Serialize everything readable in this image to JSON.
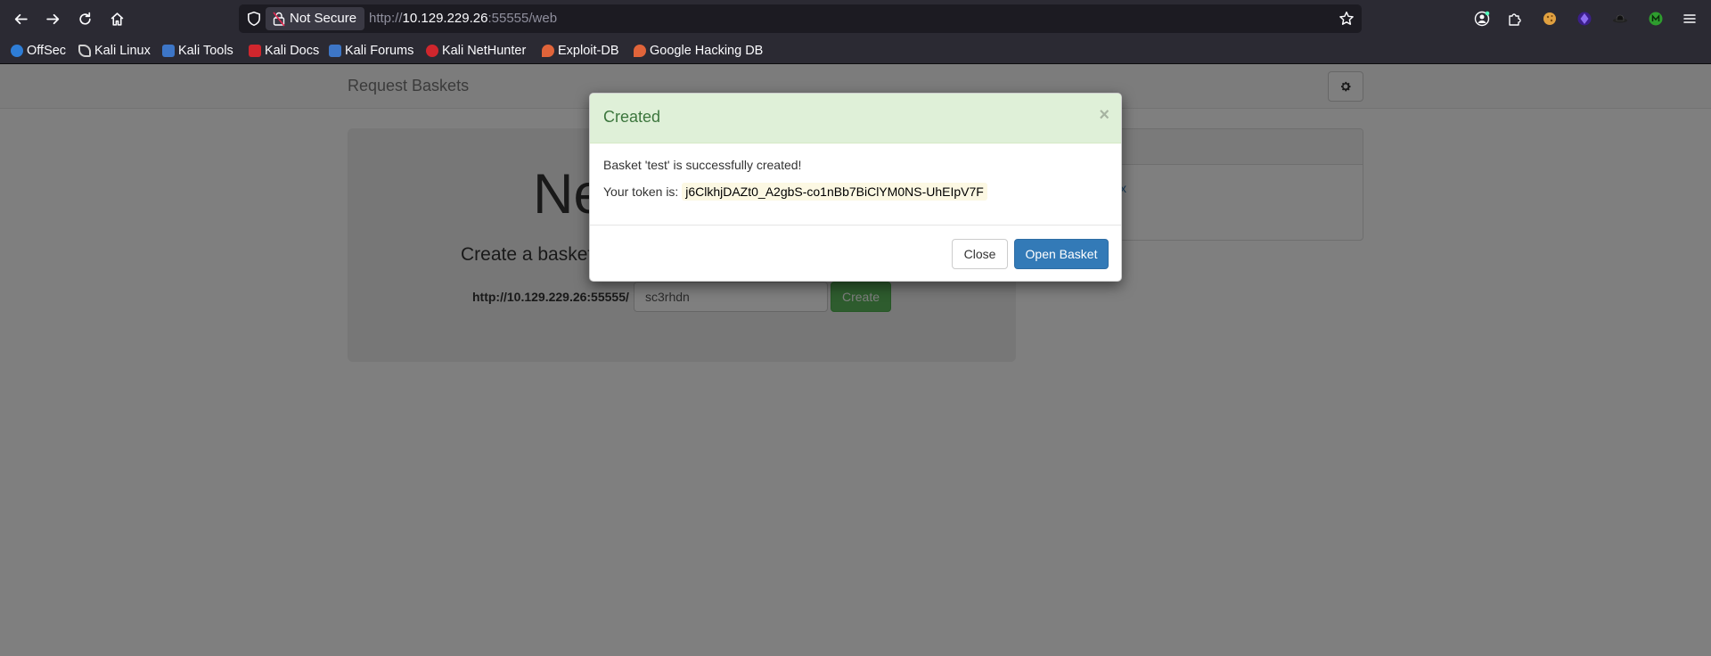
{
  "browser": {
    "security_label": "Not Secure",
    "url_prefix": "http://",
    "url_host": "10.129.229.26",
    "url_rest": ":55555/web"
  },
  "bookmarks": [
    {
      "label": "OffSec",
      "color": "#2e7dd6"
    },
    {
      "label": "Kali Linux",
      "color": "#d0d0d0"
    },
    {
      "label": "Kali Tools",
      "color": "#3d76c7"
    },
    {
      "label": "Kali Docs",
      "color": "#d0262d"
    },
    {
      "label": "Kali Forums",
      "color": "#3d76c7"
    },
    {
      "label": "Kali NetHunter",
      "color": "#d0262d"
    },
    {
      "label": "Exploit-DB",
      "color": "#e0643a"
    },
    {
      "label": "Google Hacking DB",
      "color": "#e0643a"
    }
  ],
  "page": {
    "brand": "Request Baskets",
    "jumbotron": {
      "title": "Ne",
      "subtitle": "Create a basket",
      "url_prefix": "http://10.129.229.26:55555/",
      "input_value": "sc3rhdn",
      "create_label": "Create"
    },
    "side_link": "x"
  },
  "modal": {
    "title": "Created",
    "close_glyph": "×",
    "message": "Basket 'test' is successfully created!",
    "token_label": "Your token is:",
    "token": "j6ClkhjDAZt0_A2gbS-co1nBb7BiClYM0NS-UhEIpV7F",
    "close_button": "Close",
    "open_button": "Open Basket"
  },
  "colors": {
    "modal_header_bg": "#dff0d8",
    "modal_title": "#3c763d",
    "primary": "#337ab7",
    "success": "#5cb85c"
  }
}
